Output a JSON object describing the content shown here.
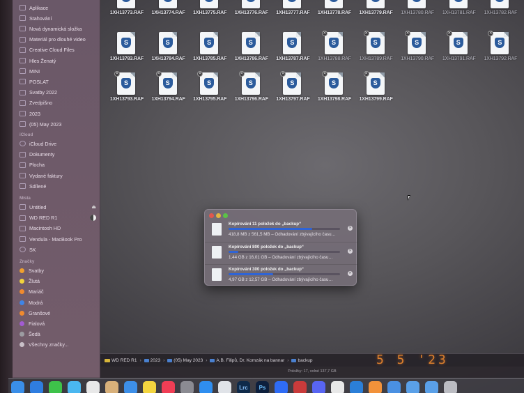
{
  "sidebar": {
    "favorites": [
      {
        "label": "Aplikace",
        "icon": "applications-icon"
      },
      {
        "label": "Stahování",
        "icon": "downloads-icon"
      },
      {
        "label": "Nová dynamická složka",
        "icon": "smart-folder-icon"
      },
      {
        "label": "Materiál pro dlouhé video",
        "icon": "folder-icon"
      },
      {
        "label": "Creative Cloud Files",
        "icon": "folder-icon"
      },
      {
        "label": "Hles Ženatý",
        "icon": "folder-icon"
      },
      {
        "label": "MINI",
        "icon": "folder-icon"
      },
      {
        "label": "POSLAT",
        "icon": "folder-icon"
      },
      {
        "label": "Svatby 2022",
        "icon": "folder-icon"
      },
      {
        "label": "Zvedpišno",
        "icon": "folder-icon"
      },
      {
        "label": "2023",
        "icon": "folder-icon"
      },
      {
        "label": "(05) May 2023",
        "icon": "folder-icon"
      }
    ],
    "icloud_header": "iCloud",
    "icloud": [
      {
        "label": "iCloud Drive",
        "icon": "icloud-icon"
      },
      {
        "label": "Dokumenty",
        "icon": "document-icon"
      },
      {
        "label": "Plocha",
        "icon": "desktop-icon"
      },
      {
        "label": "Vydané faktury",
        "icon": "folder-icon"
      },
      {
        "label": "Sdílené",
        "icon": "shared-folder-icon"
      }
    ],
    "locations_header": "Místa",
    "locations": [
      {
        "label": "Untitled",
        "icon": "drive-icon",
        "extra": "⏏"
      },
      {
        "label": "WD RED R1",
        "icon": "drive-icon",
        "extra": "progress"
      },
      {
        "label": "Macintosh HD",
        "icon": "drive-icon"
      },
      {
        "label": "Vendula - MacBook Pro",
        "icon": "laptop-icon"
      },
      {
        "label": "SK",
        "icon": "network-icon"
      }
    ],
    "tags_header": "Značky",
    "tags": [
      {
        "label": "Svatby",
        "color": "#f0a12e"
      },
      {
        "label": "Žlutá",
        "color": "#f3d33c"
      },
      {
        "label": "Mariáč",
        "color": "#f08a2e"
      },
      {
        "label": "Modrá",
        "color": "#3f84e6"
      },
      {
        "label": "Granšové",
        "color": "#f08a2e"
      },
      {
        "label": "Fialová",
        "color": "#a25bd2"
      },
      {
        "label": "Šedá",
        "color": "#9c9ca2"
      },
      {
        "label": "Všechny značky...",
        "color": "#c9c0c8"
      }
    ]
  },
  "files": {
    "row1": [
      "1XH13773.RAF",
      "1XH13774.RAF",
      "1XH13775.RAF",
      "1XH13776.RAF",
      "1XH13777.RAF",
      "1XH13778.RAF",
      "1XH13779.RAF",
      "1XH13780.RAF",
      "1XH13781.RAF",
      "1XH13782.RAF"
    ],
    "row2": [
      "1XH13783.RAF",
      "1XH13784.RAF",
      "1XH13785.RAF",
      "1XH13786.RAF",
      "1XH13787.RAF",
      "1XH13788.RAF",
      "1XH13789.RAF",
      "1XH13790.RAF",
      "1XH13791.RAF",
      "1XH13792.RAF"
    ],
    "row3": [
      "1XH13793.RAF",
      "1XH13794.RAF",
      "1XH13795.RAF",
      "1XH13796.RAF",
      "1XH13797.RAF",
      "1XH13798.RAF",
      "1XH13799.RAF"
    ]
  },
  "copy_dialog": {
    "rows": [
      {
        "title": "Kopírování 11 položek do „backup“",
        "status": "418,8 MB z 561,5 MB – Odhadování zbývajícího času…",
        "progress": 0.75
      },
      {
        "title": "Kopírování 800 položek do „backup“",
        "status": "1,44 GB z 16,01 GB – Odhadování zbývajícího času…",
        "progress": 0.09
      },
      {
        "title": "Kopírování 300 položek do „backup“",
        "status": "4,97 GB z 12,57 GB – Odhadování zbývajícího času…",
        "progress": 0.4
      }
    ],
    "colors": {
      "close": "#e0574d",
      "minimize": "#e2b540",
      "zoom": "#5bc247",
      "accent": "#2f64d6"
    }
  },
  "pathbar": {
    "crumbs": [
      "WD RED R1",
      "2023",
      "(05) May 2023",
      "A.B. Filipů, Dr. Komzák na bannar",
      "backup"
    ]
  },
  "statusbar": {
    "text": "Položky: 17, volné 137,7 GB"
  },
  "photo_datestamp": "5 5 '23",
  "dock": {
    "icons": [
      "finder-icon",
      "safari-icon",
      "messages-icon",
      "calendar-icon",
      "photos-icon",
      "contacts-icon",
      "mail-icon",
      "notes-icon",
      "music-icon",
      "system-preferences-icon",
      "app-store-icon",
      "preview-icon",
      "lightroom-classic-icon",
      "photoshop-icon",
      "messenger-icon",
      "bridge-icon",
      "discord-icon",
      "chrome-icon",
      "vscode-icon",
      "pages-icon",
      "cloud-icon",
      "folder-icon",
      "downloads-icon",
      "trash-icon"
    ],
    "lrc_label": "Lrc",
    "ps_label": "Ps"
  }
}
